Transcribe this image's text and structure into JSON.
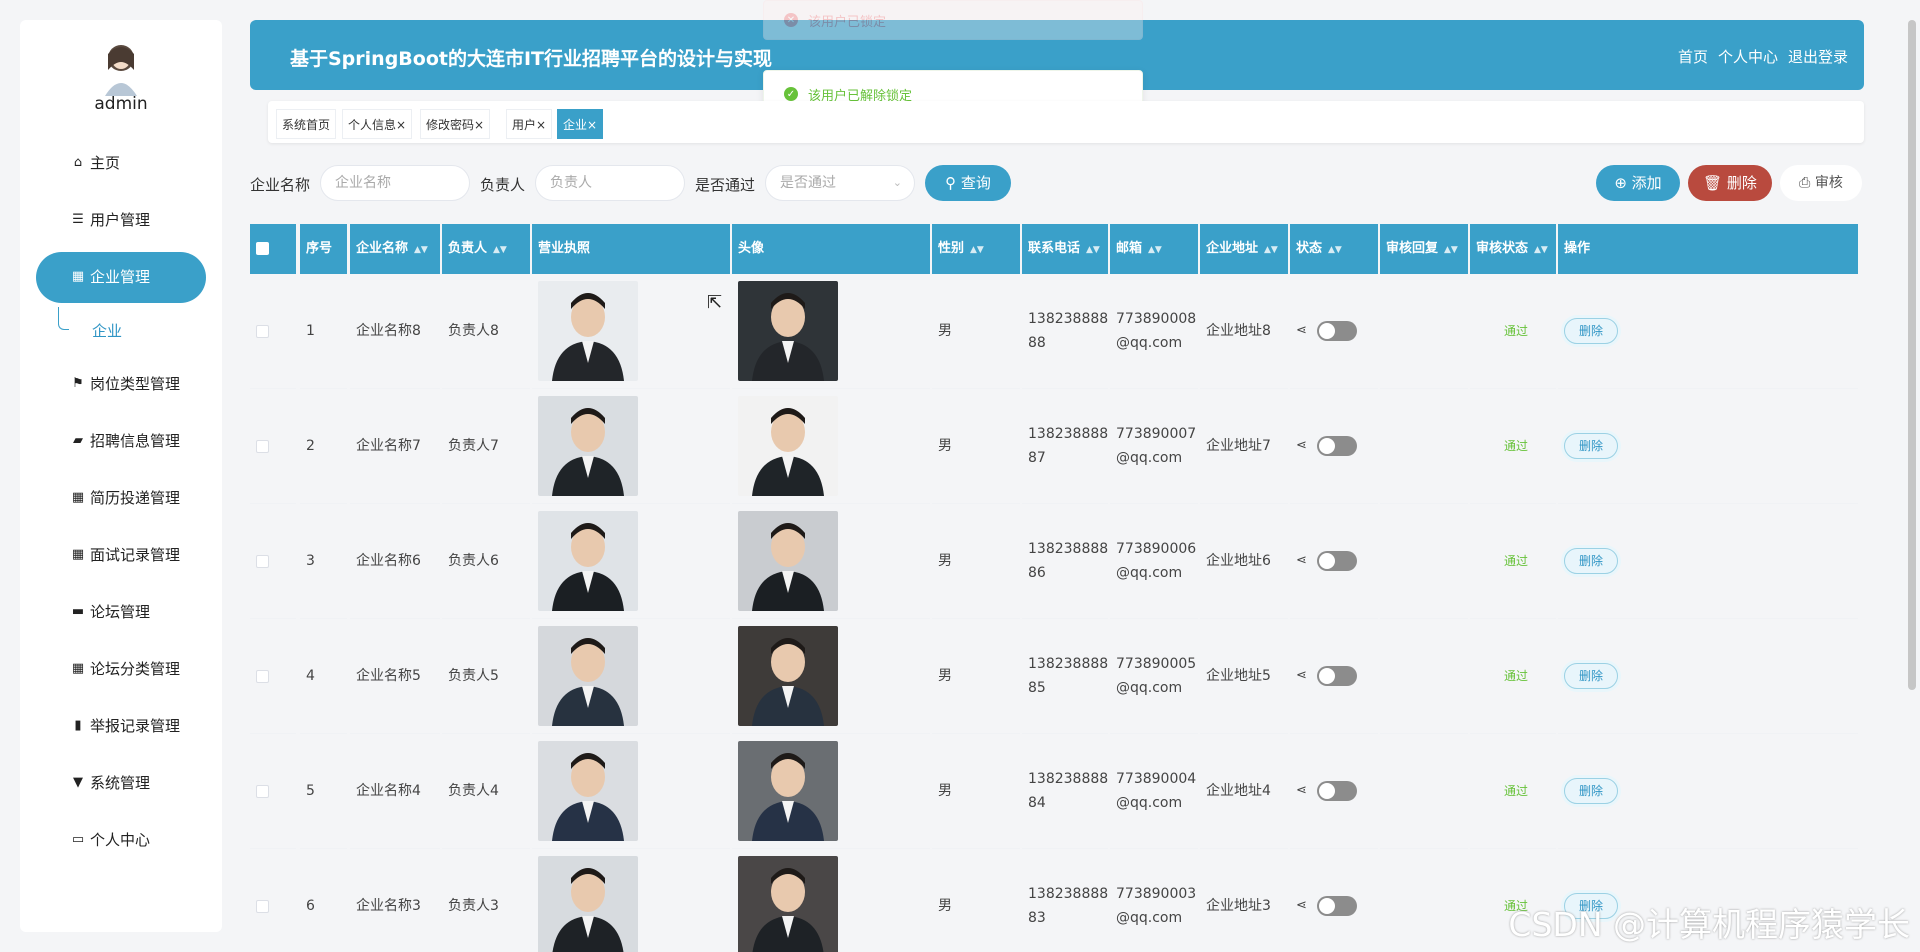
{
  "app": {
    "title": "基于SpringBoot的大连市IT行业招聘平台的设计与实现",
    "nav": [
      "首页",
      "个人中心",
      "退出登录"
    ]
  },
  "user": {
    "name": "admin"
  },
  "sidebar": {
    "items": [
      {
        "label": "主页",
        "icon": "home-icon"
      },
      {
        "label": "用户管理",
        "icon": "list-icon"
      },
      {
        "label": "企业管理",
        "icon": "grid-icon",
        "active": true
      },
      {
        "label": "岗位类型管理",
        "icon": "flag-icon"
      },
      {
        "label": "招聘信息管理",
        "icon": "ticket-icon"
      },
      {
        "label": "简历投递管理",
        "icon": "grid-icon"
      },
      {
        "label": "面试记录管理",
        "icon": "grid-icon"
      },
      {
        "label": "论坛管理",
        "icon": "briefcase-icon"
      },
      {
        "label": "论坛分类管理",
        "icon": "grid-icon"
      },
      {
        "label": "举报记录管理",
        "icon": "chart-icon"
      },
      {
        "label": "系统管理",
        "icon": "pin-icon"
      },
      {
        "label": "个人中心",
        "icon": "card-icon"
      }
    ],
    "sub_item": "企业"
  },
  "tabs": [
    {
      "label": "系统首页",
      "closable": false
    },
    {
      "label": "个人信息",
      "closable": true
    },
    {
      "label": "修改密码",
      "closable": true
    },
    {
      "label": "用户",
      "closable": true
    },
    {
      "label": "企业",
      "closable": true,
      "active": true
    }
  ],
  "close_glyph": "×",
  "toasts": {
    "fading": "该用户已锁定",
    "current": "该用户已解除锁定"
  },
  "search": {
    "company_label": "企业名称",
    "company_placeholder": "企业名称",
    "owner_label": "负责人",
    "owner_placeholder": "负责人",
    "pass_label": "是否通过",
    "pass_placeholder": "是否通过",
    "query_button": "查询",
    "add_button": "添加",
    "delete_button": "删除",
    "audit_button": "审核"
  },
  "table": {
    "headers": [
      "序号",
      "企业名称",
      "负责人",
      "营业执照",
      "头像",
      "性别",
      "联系电话",
      "邮箱",
      "企业地址",
      "状态",
      "审核回复",
      "审核状态",
      "操作"
    ],
    "rows": [
      {
        "no": "1",
        "company": "企业名称8",
        "owner": "负责人8",
        "gender": "男",
        "phone1": "138238888",
        "phone2": "88",
        "email1": "773890008",
        "email2": "@qq.com",
        "address": "企业地址8",
        "audit_status": "通过",
        "action": "删除"
      },
      {
        "no": "2",
        "company": "企业名称7",
        "owner": "负责人7",
        "gender": "男",
        "phone1": "138238888",
        "phone2": "87",
        "email1": "773890007",
        "email2": "@qq.com",
        "address": "企业地址7",
        "audit_status": "通过",
        "action": "删除"
      },
      {
        "no": "3",
        "company": "企业名称6",
        "owner": "负责人6",
        "gender": "男",
        "phone1": "138238888",
        "phone2": "86",
        "email1": "773890006",
        "email2": "@qq.com",
        "address": "企业地址6",
        "audit_status": "通过",
        "action": "删除"
      },
      {
        "no": "4",
        "company": "企业名称5",
        "owner": "负责人5",
        "gender": "男",
        "phone1": "138238888",
        "phone2": "85",
        "email1": "773890005",
        "email2": "@qq.com",
        "address": "企业地址5",
        "audit_status": "通过",
        "action": "删除"
      },
      {
        "no": "5",
        "company": "企业名称4",
        "owner": "负责人4",
        "gender": "男",
        "phone1": "138238888",
        "phone2": "84",
        "email1": "773890004",
        "email2": "@qq.com",
        "address": "企业地址4",
        "audit_status": "通过",
        "action": "删除"
      },
      {
        "no": "6",
        "company": "企业名称3",
        "owner": "负责人3",
        "gender": "男",
        "phone1": "138238888",
        "phone2": "83",
        "email1": "773890003",
        "email2": "@qq.com",
        "address": "企业地址3",
        "audit_status": "通过",
        "action": "删除"
      }
    ]
  },
  "watermark": "CSDN @计算机程序猿学长",
  "colors": {
    "primary": "#3aa0c9",
    "danger": "#b94a3e",
    "success": "#67c23a"
  }
}
